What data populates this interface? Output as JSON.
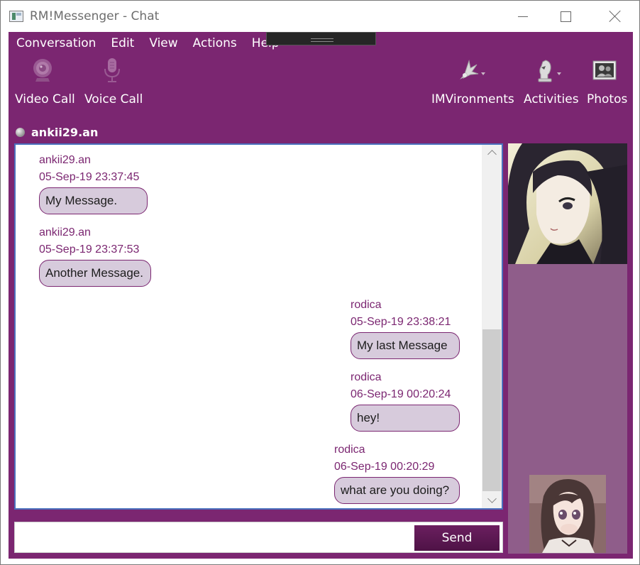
{
  "window": {
    "title": "RM!Messenger - Chat"
  },
  "menu": {
    "items": [
      "Conversation",
      "Edit",
      "View",
      "Actions",
      "Help"
    ]
  },
  "toolbar": {
    "video_call": "Video Call",
    "voice_call": "Voice Call",
    "imvironments": "IMVironments",
    "activities": "Activities",
    "photos": "Photos"
  },
  "contact": {
    "name": "ankii29.an"
  },
  "messages": [
    {
      "sender": "ankii29.an",
      "time": "05-Sep-19 23:37:45",
      "text": "My Message.",
      "side": "left"
    },
    {
      "sender": "ankii29.an",
      "time": "05-Sep-19 23:37:53",
      "text": "Another Message.",
      "side": "left"
    },
    {
      "sender": "rodica",
      "time": "05-Sep-19 23:38:21",
      "text": "My last Message",
      "side": "right"
    },
    {
      "sender": "rodica",
      "time": "06-Sep-19 00:20:24",
      "text": "hey!",
      "side": "right"
    },
    {
      "sender": "rodica",
      "time": "06-Sep-19 00:20:29",
      "text": "what are you doing?",
      "side": "right"
    }
  ],
  "composer": {
    "placeholder": "",
    "send_label": "Send"
  },
  "colors": {
    "frame": "#7b2671",
    "side_panel": "#8f5d8a",
    "bubble_fill": "#d7cbdc",
    "sender_text": "#7b2671"
  }
}
